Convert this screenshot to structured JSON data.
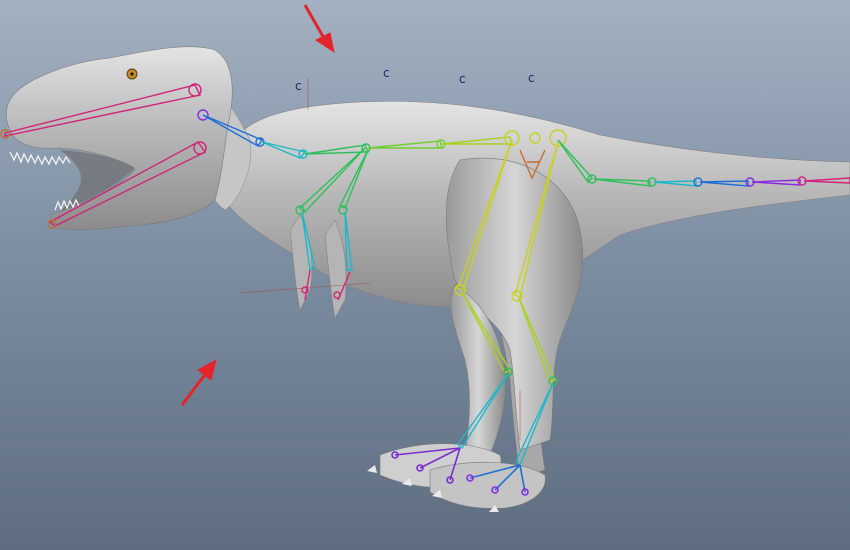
{
  "viewport": {
    "background_top": "#a3b1c2",
    "background_bottom": "#5e6d80",
    "model_color": "#c9c9c9",
    "arrow_color": "#e3242b"
  },
  "locators": [
    {
      "label": "c"
    },
    {
      "label": "c"
    },
    {
      "label": "c"
    },
    {
      "label": "c"
    }
  ],
  "joint_colors": {
    "head": "#d0257a",
    "neck": "#1d6fd6",
    "spine": "#2fbf5a",
    "arm": "#1db8c8",
    "leg": "#c8d21d",
    "tail": "#8a2be2",
    "toe": "#7b2fd0"
  },
  "icons": [
    "arrow-down-right-icon",
    "arrow-up-right-icon"
  ]
}
